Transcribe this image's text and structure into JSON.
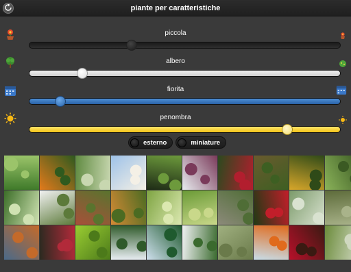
{
  "header": {
    "title": "piante per caratteristiche",
    "back_icon": "refresh-icon"
  },
  "filters": [
    {
      "key": "size",
      "label": "piccola",
      "left_icon": "flower-pot-icon",
      "right_icon": "small-flower-icon",
      "value": 0.33,
      "style": "dark"
    },
    {
      "key": "type",
      "label": "albero",
      "left_icon": "tree-icon",
      "right_icon": "shrub-icon",
      "value": 0.17,
      "style": "light"
    },
    {
      "key": "season",
      "label": "fiorita",
      "left_icon": "calendar-icon",
      "right_icon": "calendar-icon",
      "value": 0.1,
      "style": "blue"
    },
    {
      "key": "light",
      "label": "penombra",
      "left_icon": "sun-icon",
      "right_icon": "small-sun-icon",
      "value": 0.83,
      "style": "yellow"
    }
  ],
  "toggles": [
    {
      "label": "esterno",
      "on": false
    },
    {
      "label": "miniature",
      "on": false
    }
  ],
  "gallery": {
    "tiles": [
      {
        "name": "plant-tile",
        "colors": [
          "#3f7a2a",
          "#9bc46a"
        ]
      },
      {
        "name": "plant-tile",
        "colors": [
          "#e27a1c",
          "#2f5a1e"
        ]
      },
      {
        "name": "plant-tile",
        "colors": [
          "#5f8a40",
          "#c8d7b0"
        ]
      },
      {
        "name": "plant-tile",
        "colors": [
          "#9ec2e8",
          "#f4f0e6"
        ]
      },
      {
        "name": "plant-tile",
        "colors": [
          "#1e2b16",
          "#6d9a3c"
        ]
      },
      {
        "name": "plant-tile",
        "colors": [
          "#e8ecef",
          "#7a3a5a"
        ]
      },
      {
        "name": "plant-tile",
        "colors": [
          "#2b4a1e",
          "#b21e2e"
        ]
      },
      {
        "name": "plant-tile",
        "colors": [
          "#6a5a2e",
          "#3d5f22"
        ]
      },
      {
        "name": "plant-tile",
        "colors": [
          "#d8a72a",
          "#2f4a18"
        ]
      },
      {
        "name": "plant-tile",
        "colors": [
          "#8bb35a",
          "#3b5a23"
        ]
      },
      {
        "name": "plant-tile",
        "colors": [
          "#3c6e28",
          "#cfe2b2"
        ]
      },
      {
        "name": "plant-tile",
        "colors": [
          "#f1f1f1",
          "#5c7a3a"
        ]
      },
      {
        "name": "plant-tile",
        "colors": [
          "#a8503a",
          "#59742e"
        ]
      },
      {
        "name": "plant-tile",
        "colors": [
          "#d58a35",
          "#4b6b22"
        ]
      },
      {
        "name": "plant-tile",
        "colors": [
          "#7ea442",
          "#dbe8b0"
        ]
      },
      {
        "name": "plant-tile",
        "colors": [
          "#6a9a36",
          "#c9d88a"
        ]
      },
      {
        "name": "plant-tile",
        "colors": [
          "#8c8a7a",
          "#4f6d36"
        ]
      },
      {
        "name": "plant-tile",
        "colors": [
          "#1f3a14",
          "#c21e2a"
        ]
      },
      {
        "name": "plant-tile",
        "colors": [
          "#7b9a6a",
          "#d9e2d0"
        ]
      },
      {
        "name": "plant-tile",
        "colors": [
          "#5d6b3a",
          "#a9b38a"
        ]
      },
      {
        "name": "plant-tile",
        "colors": [
          "#4a6a8a",
          "#c46a2a"
        ]
      },
      {
        "name": "plant-tile",
        "colors": [
          "#2a2a20",
          "#b22a3a"
        ]
      },
      {
        "name": "plant-tile",
        "colors": [
          "#9acd32",
          "#4c7a1a"
        ]
      },
      {
        "name": "plant-tile",
        "colors": [
          "#e9eef3",
          "#2f5a2a"
        ]
      },
      {
        "name": "plant-tile",
        "colors": [
          "#cfe0ee",
          "#1f5a2e"
        ]
      },
      {
        "name": "plant-tile",
        "colors": [
          "#f0f2f3",
          "#3a6a2e"
        ]
      },
      {
        "name": "plant-tile",
        "colors": [
          "#a0b080",
          "#6a7a4a"
        ]
      },
      {
        "name": "plant-tile",
        "colors": [
          "#c8dde8",
          "#e06a1c"
        ]
      },
      {
        "name": "plant-tile",
        "colors": [
          "#b8102a",
          "#3a1a12"
        ]
      },
      {
        "name": "plant-tile",
        "colors": [
          "#6b8b3b",
          "#d0d8c0"
        ]
      }
    ]
  }
}
